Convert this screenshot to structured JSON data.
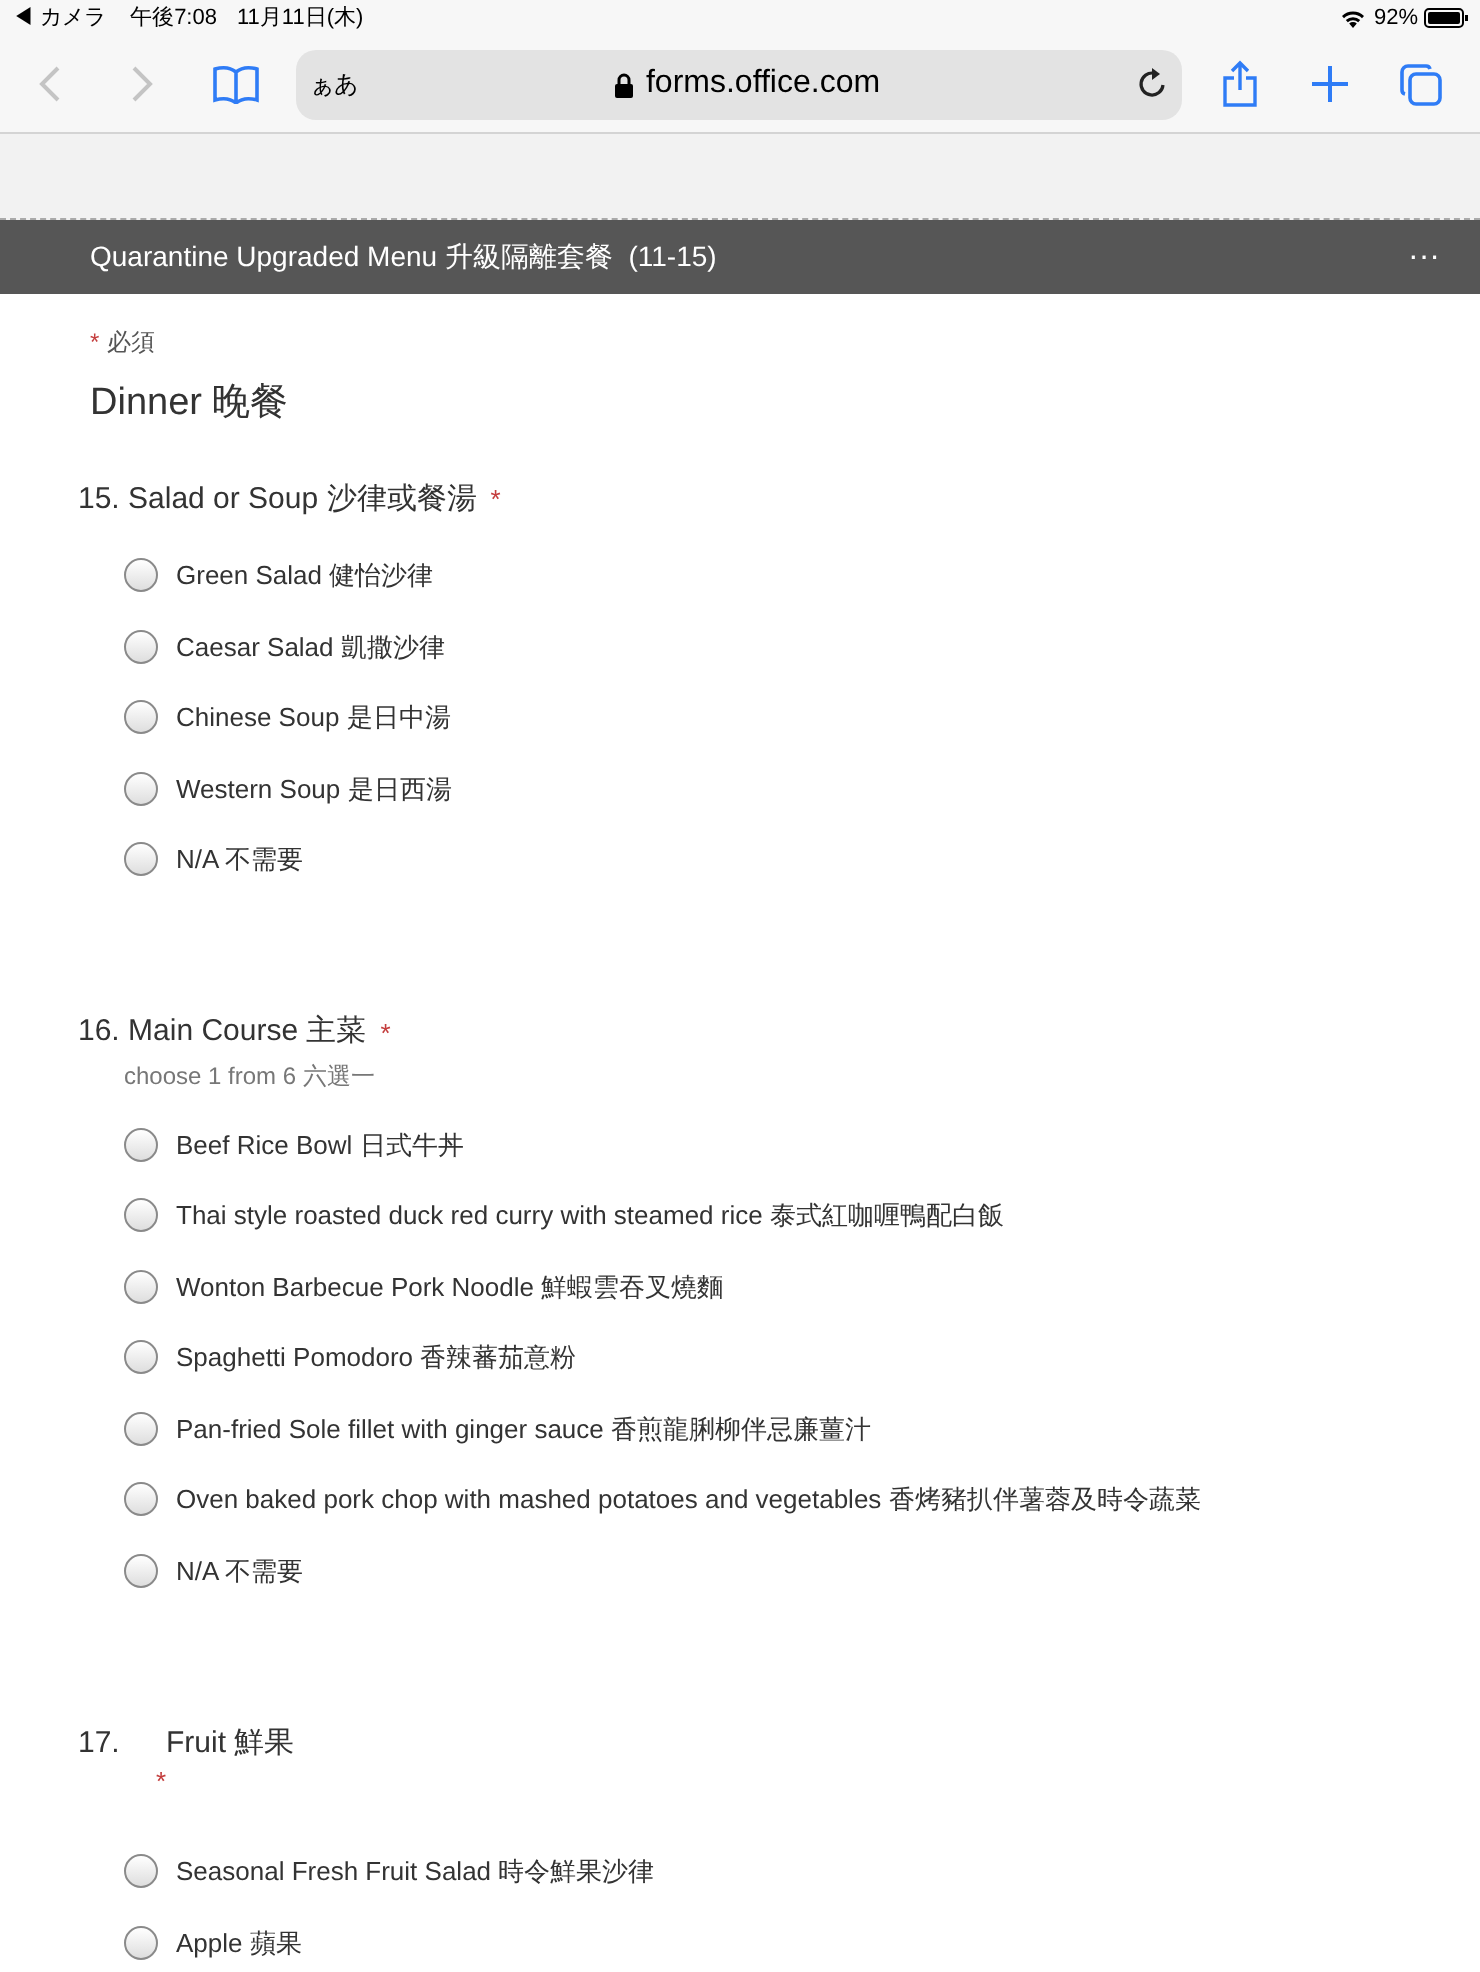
{
  "status_bar": {
    "back_app": "◀ カメラ",
    "time": "午後7:08",
    "date": "11月11日(木)",
    "battery": "92%"
  },
  "browser": {
    "text_size": "ぁあ",
    "url": "forms.office.com",
    "back_disabled": true,
    "forward_disabled": true
  },
  "form_header": {
    "title": "Quarantine Upgraded Menu 升級隔離套餐  (11-15)",
    "more": "···"
  },
  "required_note": {
    "mark": "*",
    "text": "必須"
  },
  "section_title": "Dinner 晚餐",
  "questions": [
    {
      "number": "15.",
      "title": "Salad or Soup 沙律或餐湯",
      "required": true,
      "kind": "inline",
      "options": [
        {
          "label": "Green Salad 健怡沙律",
          "selected": false
        },
        {
          "label": "Caesar Salad 凱撒沙律",
          "selected": false
        },
        {
          "label": "Chinese Soup 是日中湯",
          "selected": false
        },
        {
          "label": "Western Soup 是日西湯",
          "selected": false
        },
        {
          "label": "N/A 不需要",
          "selected": false
        }
      ]
    },
    {
      "number": "16.",
      "title": "Main Course 主菜",
      "required": true,
      "kind": "inline",
      "subtitle": "choose 1 from 6 六選一",
      "options": [
        {
          "label": "Beef Rice Bowl 日式牛丼",
          "selected": false
        },
        {
          "label": "Thai style roasted duck red curry with steamed rice 泰式紅咖喱鴨配白飯",
          "selected": false
        },
        {
          "label": "Wonton Barbecue Pork Noodle 鮮蝦雲吞叉燒麵",
          "selected": false
        },
        {
          "label": "Spaghetti Pomodoro 香辣蕃茄意粉",
          "selected": false
        },
        {
          "label": "Pan-fried Sole fillet with ginger sauce 香煎龍脷柳伴忌廉薑汁",
          "selected": false
        },
        {
          "label": "Oven baked pork chop with mashed potatoes and vegetables 香烤豬扒伴薯蓉及時令蔬菜",
          "selected": false
        },
        {
          "label": "N/A 不需要",
          "selected": false
        }
      ]
    },
    {
      "number": "17.",
      "title": "Fruit 鮮果",
      "required": true,
      "kind": "stacked",
      "options": [
        {
          "label": "Seasonal Fresh Fruit Salad 時令鮮果沙律",
          "selected": false
        },
        {
          "label": "Apple 蘋果",
          "selected": false
        }
      ]
    }
  ]
}
